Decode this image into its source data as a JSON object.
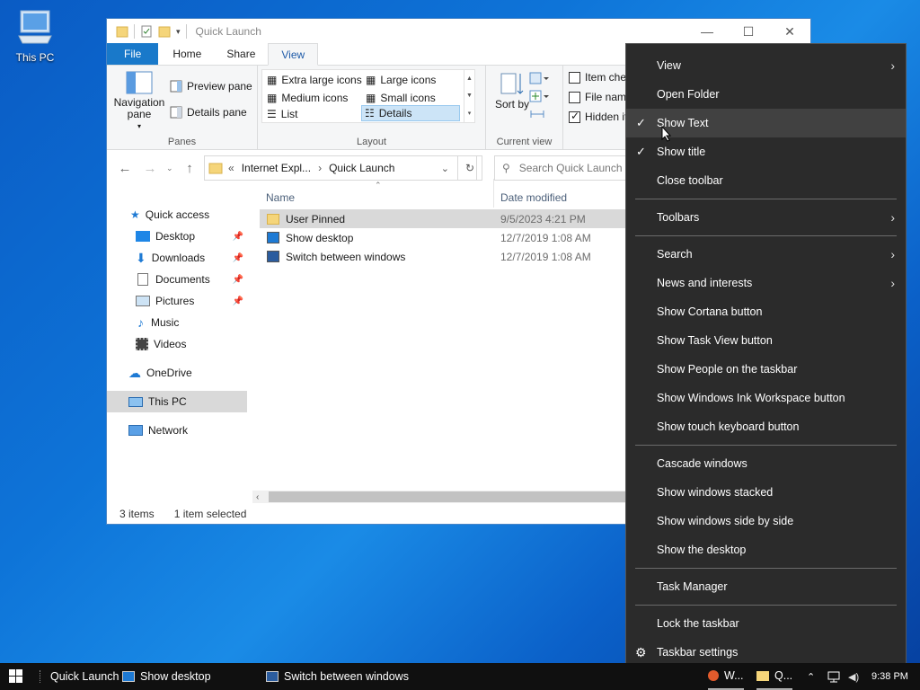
{
  "desktop": {
    "icon_label": "This PC"
  },
  "explorer": {
    "title": "Quick Launch",
    "tabs": [
      "File",
      "Home",
      "Share",
      "View"
    ],
    "ribbon": {
      "panes": {
        "nav_pane": "Navigation pane",
        "preview_pane": "Preview pane",
        "details_pane": "Details pane",
        "group": "Panes"
      },
      "layout": {
        "extra_large": "Extra large icons",
        "large": "Large icons",
        "medium": "Medium icons",
        "small": "Small icons",
        "list": "List",
        "details": "Details",
        "group": "Layout"
      },
      "current_view": {
        "sort_by": "Sort by",
        "group": "Current view"
      },
      "show_hide": {
        "item_check": "Item chec",
        "file_name": "File name",
        "hidden": "Hidden it"
      }
    },
    "address": {
      "path_prefix": "«",
      "seg1": "Internet Expl...",
      "sep": "›",
      "seg2": "Quick Launch"
    },
    "search_placeholder": "Search Quick Launch",
    "nav": {
      "quick_access": "Quick access",
      "items": [
        "Desktop",
        "Downloads",
        "Documents",
        "Pictures",
        "Music",
        "Videos"
      ],
      "onedrive": "OneDrive",
      "this_pc": "This PC",
      "network": "Network"
    },
    "columns": {
      "name": "Name",
      "date": "Date modified"
    },
    "files": [
      {
        "name": "User Pinned",
        "date": "9/5/2023 4:21 PM"
      },
      {
        "name": "Show desktop",
        "date": "12/7/2019 1:08 AM"
      },
      {
        "name": "Switch between windows",
        "date": "12/7/2019 1:08 AM"
      }
    ],
    "status": {
      "count": "3 items",
      "selected": "1 item selected"
    }
  },
  "menu": {
    "items": [
      "View",
      "Open Folder",
      "Show Text",
      "Show title",
      "Close toolbar",
      "Toolbars",
      "Search",
      "News and interests",
      "Show Cortana button",
      "Show Task View button",
      "Show People on the taskbar",
      "Show Windows Ink Workspace button",
      "Show touch keyboard button",
      "Cascade windows",
      "Show windows stacked",
      "Show windows side by side",
      "Show the desktop",
      "Task Manager",
      "Lock the taskbar",
      "Taskbar settings"
    ]
  },
  "taskbar": {
    "toolbar_name": "Quick Launch",
    "show_desktop": "Show desktop",
    "switch_windows": "Switch between windows",
    "app1": "W...",
    "app2": "Q...",
    "time": "9:38 PM"
  }
}
